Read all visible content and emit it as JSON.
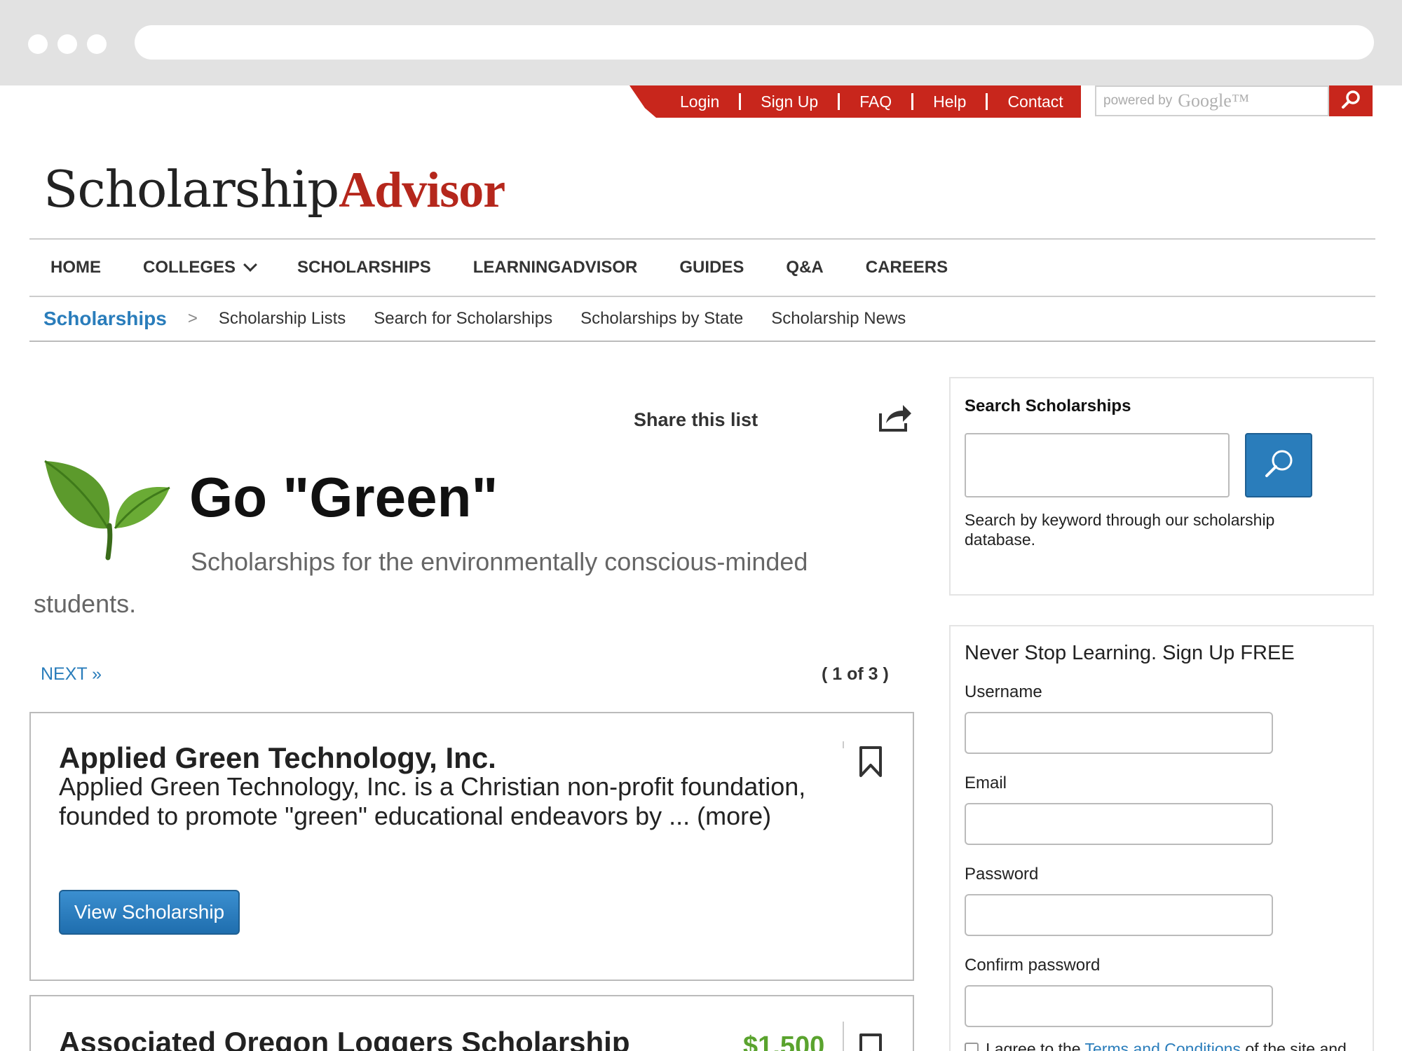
{
  "topbar": {
    "links": [
      "Login",
      "Sign Up",
      "FAQ",
      "Help",
      "Contact"
    ],
    "search_powered": "powered by",
    "search_brand": "Google™"
  },
  "logo": {
    "part1": "Scholarship",
    "part2": "Advisor"
  },
  "mainnav": {
    "items": [
      "HOME",
      "COLLEGES",
      "SCHOLARSHIPS",
      "LEARNINGADVISOR",
      "GUIDES",
      "Q&A",
      "CAREERS"
    ]
  },
  "subnav": {
    "active": "Scholarships",
    "separator": ">",
    "items": [
      "Scholarship Lists",
      "Search for Scholarships",
      "Scholarships by State",
      "Scholarship News"
    ]
  },
  "share": {
    "label": "Share this list"
  },
  "hero": {
    "title": "Go \"Green\"",
    "subtitle": "Scholarships for the environmentally conscious-minded students."
  },
  "pagination": {
    "next": "NEXT »",
    "position": "( 1 of 3 )"
  },
  "cards": [
    {
      "name": "Applied Green Technology, Inc.",
      "description": "Applied Green Technology, Inc. is a Christian non-profit foundation, founded to promote \"green\" educational endeavors by ... (more)",
      "button": "View Scholarship"
    },
    {
      "name": "Associated Oregon Loggers Scholarship",
      "amount": "$1,500"
    }
  ],
  "sidebar": {
    "search": {
      "title": "Search Scholarships",
      "help": "Search by keyword through our scholarship database."
    },
    "signup": {
      "title": "Never Stop Learning. Sign Up FREE",
      "username": "Username",
      "email": "Email",
      "password": "Password",
      "confirm": "Confirm password",
      "agree_prefix": "I agree to the ",
      "agree_link": "Terms and Conditions",
      "agree_suffix": " of the site and"
    }
  },
  "colors": {
    "brand_red": "#c8261c",
    "link_blue": "#2a7dbb",
    "amount_green": "#5aa32e"
  }
}
